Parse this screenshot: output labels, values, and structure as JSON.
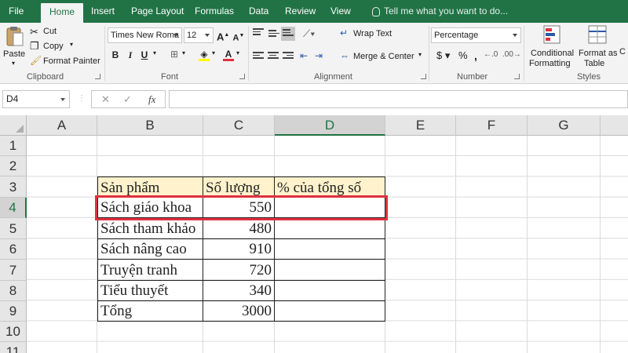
{
  "tabs": [
    "File",
    "Home",
    "Insert",
    "Page Layout",
    "Formulas",
    "Data",
    "Review",
    "View"
  ],
  "active_tab": "Home",
  "tell_me": "Tell me what you want to do...",
  "ribbon": {
    "clipboard": {
      "label": "Clipboard",
      "paste": "Paste",
      "cut": "Cut",
      "copy": "Copy",
      "format_painter": "Format Painter"
    },
    "font": {
      "label": "Font",
      "name": "Times New Roma",
      "size": "12"
    },
    "alignment": {
      "label": "Alignment",
      "wrap": "Wrap Text",
      "merge": "Merge & Center"
    },
    "number": {
      "label": "Number",
      "format": "Percentage"
    },
    "styles": {
      "label": "Styles",
      "cond": [
        "Conditional",
        "Formatting"
      ],
      "table": [
        "Format as",
        "Table"
      ]
    }
  },
  "formula_bar": {
    "name_box": "D4",
    "fx": "fx",
    "value": ""
  },
  "columns": [
    "A",
    "B",
    "C",
    "D",
    "E",
    "F",
    "G"
  ],
  "selected_column": "D",
  "rows": [
    "1",
    "2",
    "3",
    "4",
    "5",
    "6",
    "7",
    "8",
    "9",
    "10",
    "11"
  ],
  "selected_row": "4",
  "table": {
    "headers": [
      "Sản phẩm",
      "Số lượng",
      "% của tổng số"
    ],
    "rows": [
      {
        "product": "Sách giáo khoa",
        "qty": "550",
        "pct": ""
      },
      {
        "product": "Sách tham khảo",
        "qty": "480",
        "pct": ""
      },
      {
        "product": "Sách nâng cao",
        "qty": "910",
        "pct": ""
      },
      {
        "product": "Truyện tranh",
        "qty": "720",
        "pct": ""
      },
      {
        "product": "Tiểu thuyết",
        "qty": "340",
        "pct": ""
      },
      {
        "product": "Tổng",
        "qty": "3000",
        "pct": ""
      }
    ]
  },
  "colors": {
    "excel_green": "#217346",
    "highlight": "#e0313f",
    "header_fill": "#fff2cc"
  }
}
